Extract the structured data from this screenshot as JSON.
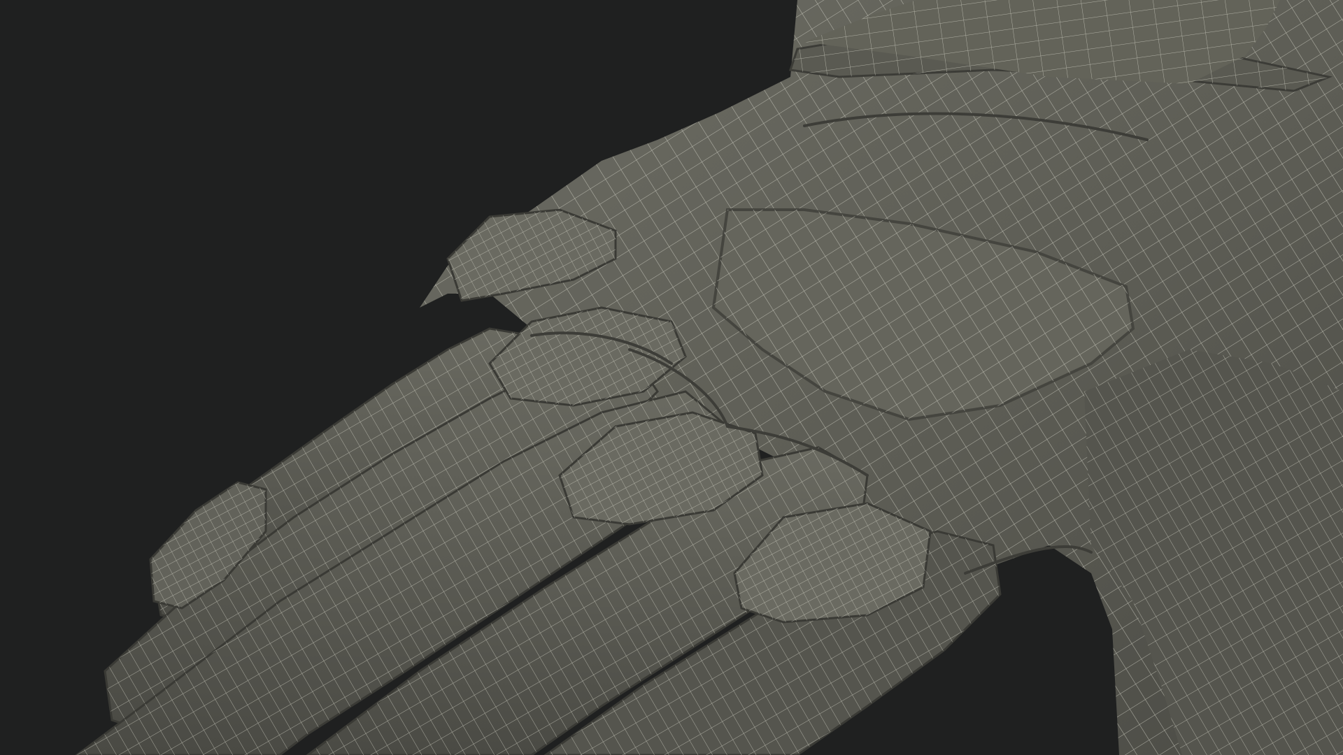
{
  "scene": {
    "subject": "glove-wireframe-render",
    "background_color": "#1f2020",
    "surface_color": "#5d5d55",
    "surface_shadow_color": "#3e3e39",
    "surface_highlight_color": "#76766c",
    "wire_color": "#d3d3c6",
    "icons": [
      "glove-mesh-icon"
    ]
  }
}
